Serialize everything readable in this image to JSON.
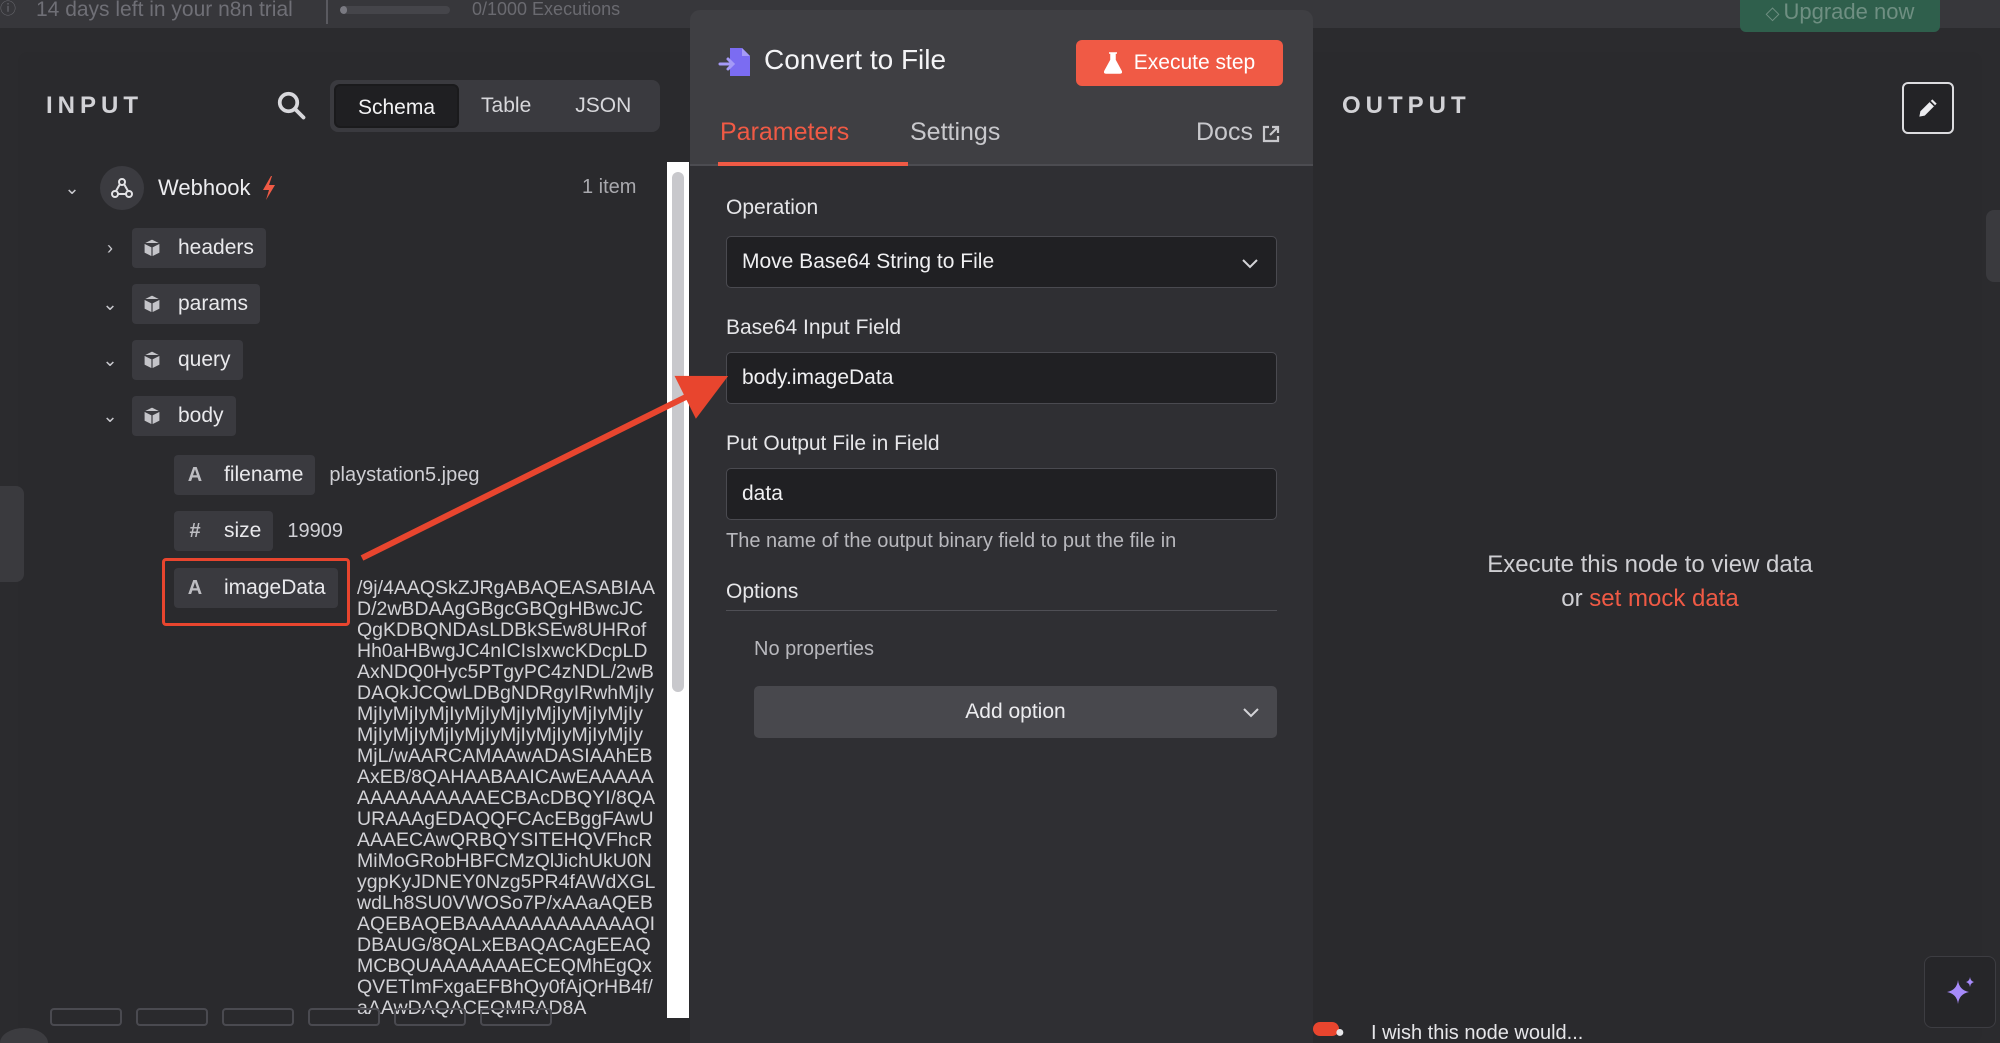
{
  "trial": {
    "text": "14 days left in your n8n trial",
    "executions": "0/1000 Executions",
    "upgrade_label": "Upgrade now",
    "execution_progress": 0.0
  },
  "input": {
    "title": "INPUT",
    "modes": [
      "Schema",
      "Table",
      "JSON"
    ],
    "active_mode": "Schema",
    "node_name": "Webhook",
    "item_count": "1 item",
    "fields": {
      "headers": "headers",
      "params": "params",
      "query": "query",
      "body": "body",
      "filename_label": "filename",
      "filename_value": "playstation5.jpeg",
      "size_label": "size",
      "size_value": "19909",
      "image_label": "imageData",
      "image_value": "/9j/4AAQSkZJRgABAQEASABIAAD/2wBDAAgGBgcGBQgHBwcJCQgKDBQNDAsLDBkSEw8UHRofHh0aHBwgJC4nICIsIxwcKDcpLDAxNDQ0Hyc5PTgyPC4zNDL/2wBDAQkJCQwLDBgNDRgyIRwhMjIyMjIyMjIyMjIyMjIyMjIyMjIyMjIyMjIyMjIyMjIyMjIyMjIyMjIyMjIyMjIyMjIyMjL/wAARCAMAAwADASIAAhEBAxEB/8QAHAABAAICAwEAAAAAAAAAAAAAAAECBAcDBQYI/8QAURAAAgEDAQQFCAcEBggFAwUAAAECAwQRBQYSITEHQVFhcRMiMoGRobHBFCMzQlJichUkU0NygpKyJDNEY0Nzg5PR4fAWdXGLwdLh8SU0VWOSo7P/xAAaAQEBAQEBAQEBAAAAAAAAAAAAAQIDBAUG/8QALxEBAQACAgEEAQMCBQUAAAAAAAECEQMhEgQxQVETImFxgaEFBhQy0fAjQrHB4f/aAAwDAQACEQMRAD8A"
    }
  },
  "node": {
    "title": "Convert to File",
    "execute_label": "Execute step",
    "tabs": {
      "parameters": "Parameters",
      "settings": "Settings",
      "docs": "Docs"
    },
    "operation_label": "Operation",
    "operation_value": "Move Base64 String to File",
    "base64_label": "Base64 Input Field",
    "base64_value": "body.imageData",
    "output_field_label": "Put Output File in Field",
    "output_field_value": "data",
    "output_field_hint": "The name of the output binary field to put the file in",
    "options_label": "Options",
    "no_properties": "No properties",
    "add_option_label": "Add option"
  },
  "output": {
    "title": "OUTPUT",
    "message_line1": "Execute this node to view data",
    "message_or": "or ",
    "mock_link": "set mock data"
  },
  "feedback": {
    "text": "I wish this node would..."
  },
  "colors": {
    "accent": "#f05a45",
    "annotation": "#e8452e",
    "upgrade_bg": "#2f5f4c"
  }
}
